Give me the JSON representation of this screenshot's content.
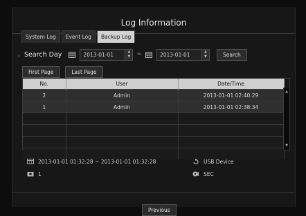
{
  "window": {
    "title": "Log Information"
  },
  "tabs": [
    {
      "label": "System Log",
      "active": false
    },
    {
      "label": "Event Log",
      "active": false
    },
    {
      "label": "Backup Log",
      "active": true
    }
  ],
  "search": {
    "label": "Search Day",
    "start_date": "2013-01-01",
    "end_date": "2013-01-01",
    "separator": "~",
    "button_label": "Search"
  },
  "paging": {
    "first_label": "First Page",
    "last_label": "Last Page",
    "previous_label": "Previous"
  },
  "table": {
    "headers": [
      "No.",
      "User",
      "Date/Time"
    ],
    "rows": [
      {
        "no": "2",
        "user": "Admin",
        "datetime": "2013-01-01 02:40:29"
      },
      {
        "no": "1",
        "user": "Admin",
        "datetime": "2013-01-01 02:38:34"
      }
    ]
  },
  "detail": {
    "range": "2013-01-01 01:32:28 ~ 2013-01-01 01:32:28",
    "channel": "1",
    "device": "USB Device",
    "format": "SEC"
  },
  "colors": {
    "active_tab": "#d2d2d2",
    "header_bg": "#cfcfcf",
    "row_bg": "#2f2f2f"
  }
}
